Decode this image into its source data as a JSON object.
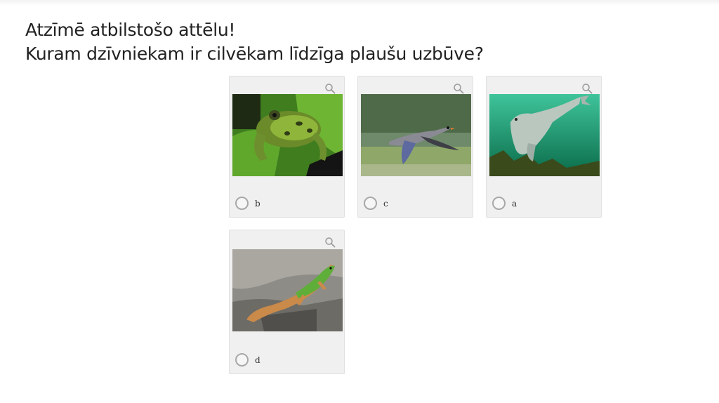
{
  "question": {
    "line1": "Atzīmē atbilstošo attēlu!",
    "line2": "Kuram dzīvniekam ir cilvēkam līdzīga plaušu uzbūve?"
  },
  "options": [
    {
      "label": "b",
      "image": "frog-on-leaf-photo",
      "selected": false
    },
    {
      "label": "c",
      "image": "goose-flying-photo",
      "selected": false
    },
    {
      "label": "a",
      "image": "seal-underwater-photo",
      "selected": false
    },
    {
      "label": "d",
      "image": "lizard-on-rock-photo",
      "selected": false
    }
  ],
  "icons": {
    "zoom": "magnifier-icon",
    "radio": "radio-button"
  },
  "colors": {
    "card_bg": "#f0f0f0",
    "radio_border": "#a8a8a8",
    "text": "#222222"
  }
}
